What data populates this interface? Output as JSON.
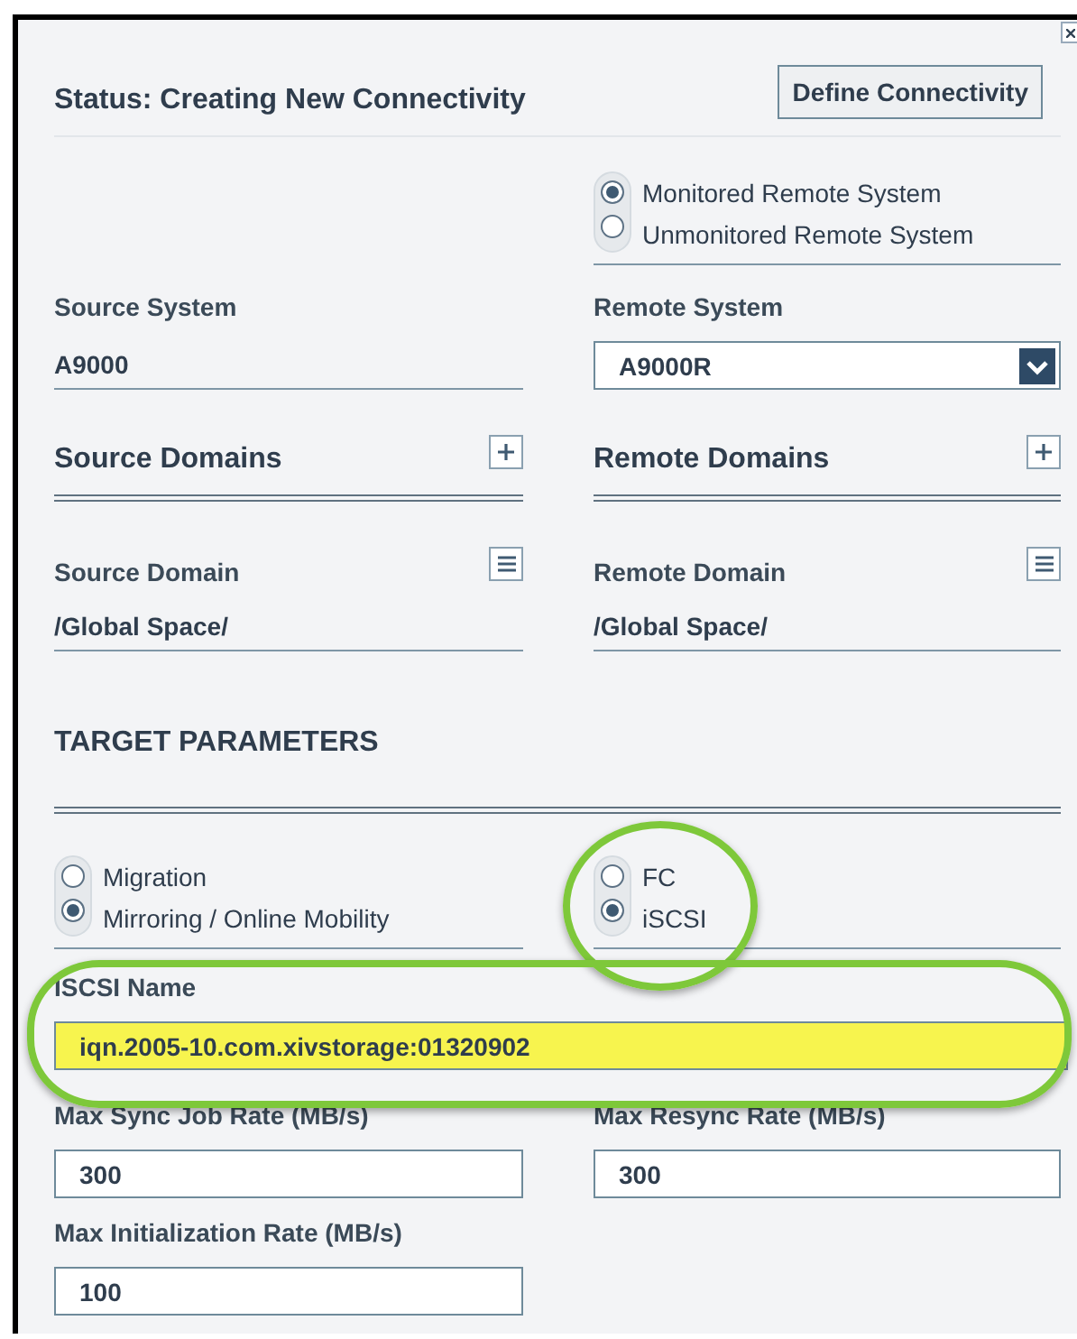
{
  "status": "Status: Creating New Connectivity",
  "define_button": "Define Connectivity",
  "remote_type": [
    {
      "label": "Monitored Remote System",
      "selected": true
    },
    {
      "label": "Unmonitored Remote System",
      "selected": false
    }
  ],
  "source_system": {
    "label": "Source System",
    "value": "A9000"
  },
  "remote_system": {
    "label": "Remote System",
    "value": "A9000R"
  },
  "domains": [
    {
      "title": "Source Domains"
    },
    {
      "title": "Remote Domains"
    }
  ],
  "domain_fields": [
    {
      "label": "Source Domain",
      "value": "/Global Space/"
    },
    {
      "label": "Remote Domain",
      "value": "/Global Space/"
    }
  ],
  "section": "TARGET PARAMETERS",
  "mode": [
    {
      "label": "Migration",
      "selected": false
    },
    {
      "label": "Mirroring / Online Mobility",
      "selected": true
    }
  ],
  "protocol": [
    {
      "label": "FC",
      "selected": false
    },
    {
      "label": "iSCSI",
      "selected": true
    }
  ],
  "iscsi": {
    "label": "ISCSI Name",
    "value": "iqn.2005-10.com.xivstorage:01320902"
  },
  "rates": [
    {
      "label": "Max Sync Job Rate (MB/s)",
      "value": "300"
    },
    {
      "label": "Max Resync Rate (MB/s)",
      "value": "300"
    },
    {
      "label": "Max Initialization Rate (MB/s)",
      "value": "100"
    }
  ]
}
